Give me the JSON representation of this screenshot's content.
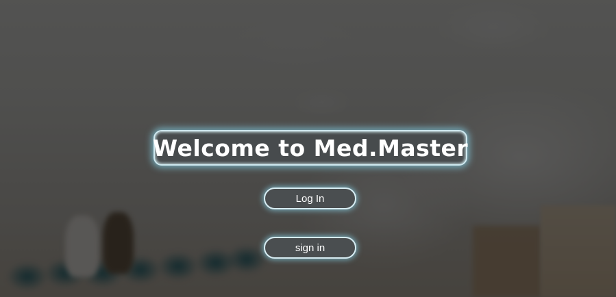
{
  "welcome": {
    "title": "Welcome to Med.Master"
  },
  "actions": {
    "login_label": "Log In",
    "signin_label": "sign in"
  },
  "theme": {
    "glow": "#82c8dc",
    "button_bg": "#4a4e50",
    "text": "#ffffff"
  }
}
